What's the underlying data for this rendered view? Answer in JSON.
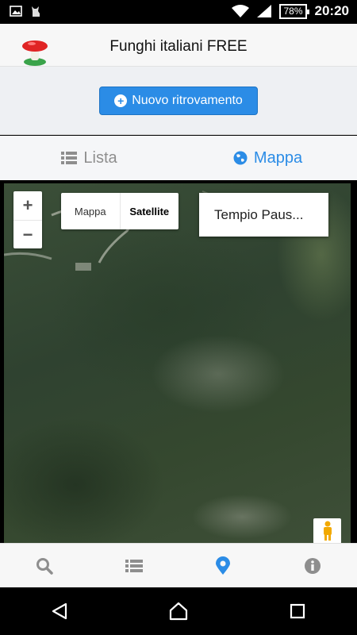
{
  "status_bar": {
    "battery": "78%",
    "time": "20:20",
    "icons": [
      "image-icon",
      "cat-icon",
      "wifi-icon",
      "signal-icon",
      "battery-icon"
    ]
  },
  "app": {
    "title": "Funghi italiani FREE",
    "logo": "mushroom-logo"
  },
  "actions": {
    "new_finding": "Nuovo ritrovamento"
  },
  "tabs": [
    {
      "label": "Lista",
      "icon": "list-icon",
      "active": false
    },
    {
      "label": "Mappa",
      "icon": "globe-icon",
      "active": true
    }
  ],
  "map": {
    "zoom_in": "+",
    "zoom_out": "−",
    "map_type_options": [
      "Mappa",
      "Satellite"
    ],
    "map_type_selected": "Satellite",
    "place": "Tempio Paus..."
  },
  "bottom_nav": [
    {
      "icon": "search-icon",
      "active": false
    },
    {
      "icon": "list-icon",
      "active": false
    },
    {
      "icon": "location-pin-icon",
      "active": true
    },
    {
      "icon": "info-icon",
      "active": false
    }
  ],
  "colors": {
    "accent": "#2b8ce6",
    "inactive": "#8e8e8e"
  }
}
